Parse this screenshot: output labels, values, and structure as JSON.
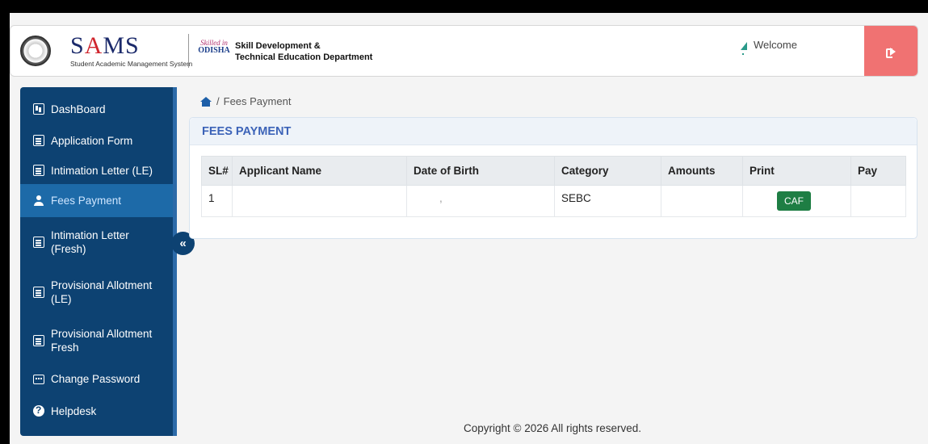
{
  "header": {
    "logo_title_s": "S",
    "logo_title_a": "A",
    "logo_title_ms": "MS",
    "logo_subtitle": "Student Academic Management System",
    "skilled_top": "Skilled in",
    "skilled_bottom": "ODISHA",
    "dept_line1": "Skill Development &",
    "dept_line2": "Technical Education Department",
    "welcome": "Welcome",
    "logout_icon": "sign-out-icon"
  },
  "sidebar": {
    "items": [
      {
        "label": "DashBoard",
        "icon": "dashboard-icon"
      },
      {
        "label": "Application Form",
        "icon": "edit-form-icon"
      },
      {
        "label": "Intimation Letter (LE)",
        "icon": "document-icon"
      },
      {
        "label": "Fees Payment",
        "icon": "user-payment-icon"
      },
      {
        "label": "Intimation Letter (Fresh)",
        "icon": "document-icon"
      },
      {
        "label": "Provisional Allotment (LE)",
        "icon": "document-icon"
      },
      {
        "label": "Provisional Allotment Fresh",
        "icon": "document-icon"
      },
      {
        "label": "Change Password",
        "icon": "keyboard-icon"
      },
      {
        "label": "Helpdesk",
        "icon": "help-icon"
      }
    ],
    "active_index": 3,
    "collapse_label": "«"
  },
  "breadcrumb": {
    "separator": "/",
    "current": "Fees Payment"
  },
  "main": {
    "card_title": "FEES PAYMENT",
    "columns": [
      "SL#",
      "Applicant Name",
      "Date of Birth",
      "Category",
      "Amounts",
      "Print",
      "Pay"
    ],
    "rows": [
      {
        "sl": "1",
        "name": "",
        "dob": ",",
        "category": "SEBC",
        "amount": "",
        "print_label": "CAF",
        "pay": ""
      }
    ]
  },
  "footer": "Copyright © 2026 All rights reserved.",
  "colors": {
    "sidebar": "#0d4272",
    "active": "#1d6aa8",
    "logout": "#f07272",
    "caf": "#1e7e44",
    "title": "#3c63b8"
  }
}
